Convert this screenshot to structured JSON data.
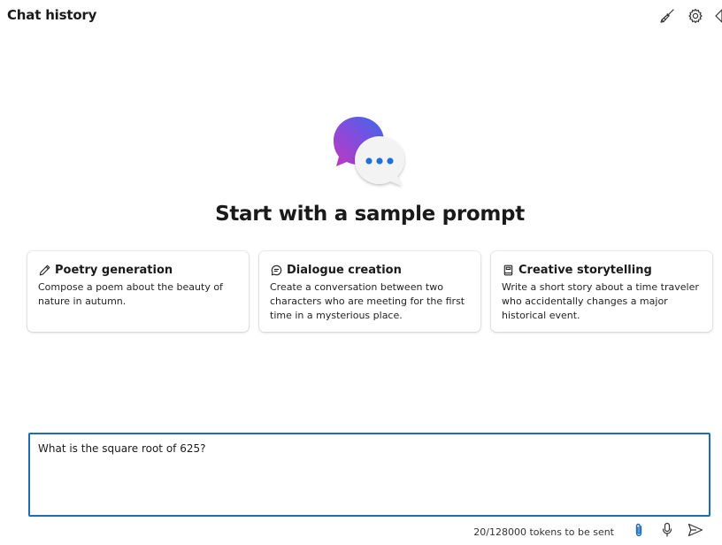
{
  "header": {
    "title": "Chat history",
    "actions": [
      {
        "name": "broom-icon",
        "label": ""
      },
      {
        "name": "gear-icon",
        "label": ""
      },
      {
        "name": "collapse-panel-icon",
        "label": ""
      }
    ]
  },
  "hero": {
    "title": "Start with a sample prompt",
    "colors": {
      "bubble_gradient_start": "#c038c0",
      "bubble_gradient_end": "#3b6ae6",
      "dots": "#1f73d6"
    }
  },
  "cards": [
    {
      "icon": "pencil-icon",
      "title": "Poetry generation",
      "description": "Compose a poem about the beauty of nature in autumn."
    },
    {
      "icon": "chat-bubble-icon",
      "title": "Dialogue creation",
      "description": "Create a conversation between two characters who are meeting for the first time in a mysterious place."
    },
    {
      "icon": "book-icon",
      "title": "Creative storytelling",
      "description": "Write a short story about a time traveler who accidentally changes a major historical event."
    }
  ],
  "input": {
    "value": "What is the square root of 625?",
    "border_color": "#1c6db3"
  },
  "footer": {
    "token_text": "20/128000 tokens to be sent",
    "actions": [
      "paperclip-icon",
      "microphone-icon",
      "send-icon"
    ],
    "accent": "#1c6db3"
  }
}
